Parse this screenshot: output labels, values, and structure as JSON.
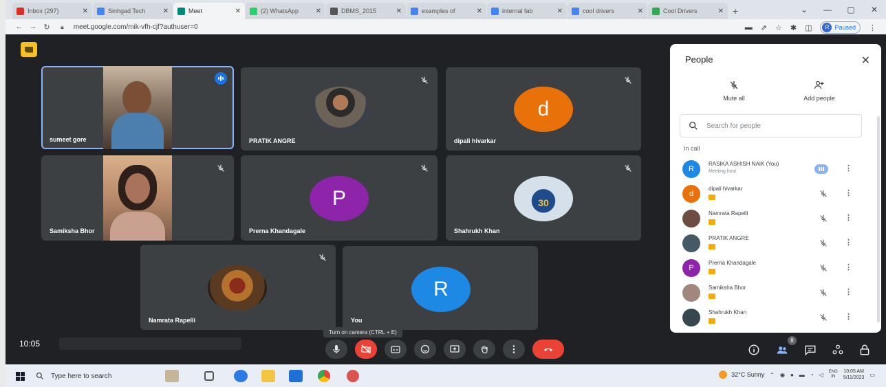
{
  "browser": {
    "tabs": [
      {
        "label": "Inbox (297)",
        "color": "#d93025",
        "active": false
      },
      {
        "label": "Sinhgad Tech",
        "color": "#4285f4",
        "active": false
      },
      {
        "label": "Meet",
        "color": "#00897b",
        "active": true
      },
      {
        "label": "(2) WhatsApp",
        "color": "#25d366",
        "active": false
      },
      {
        "label": "DBMS_2015",
        "color": "#555555",
        "active": false
      },
      {
        "label": "examples of",
        "color": "#4285f4",
        "active": false
      },
      {
        "label": "internal fab",
        "color": "#4285f4",
        "active": false
      },
      {
        "label": "cool drivers",
        "color": "#4285f4",
        "active": false
      },
      {
        "label": "Cool Drivers",
        "color": "#34a853",
        "active": false
      }
    ],
    "new_tab": "+",
    "url": "meet.google.com/mik-vfh-cjf?authuser=0",
    "profile_initial": "R",
    "profile_label": "Paused"
  },
  "meet": {
    "tiles": [
      {
        "name": "sumeet gore",
        "kind": "video"
      },
      {
        "name": "PRATIK ANGRE",
        "kind": "photo"
      },
      {
        "name": "dipali hivarkar",
        "kind": "avatar",
        "initial": "d",
        "color": "#e8710a"
      },
      {
        "name": "Samiksha Bhor",
        "kind": "video"
      },
      {
        "name": "Prerna Khandagale",
        "kind": "avatar",
        "initial": "P",
        "color": "#8e24aa"
      },
      {
        "name": "Shahrukh Khan",
        "kind": "photo",
        "jersey": "30"
      },
      {
        "name": "Namrata Rapelli",
        "kind": "photo"
      },
      {
        "name": "You",
        "kind": "avatar",
        "initial": "R",
        "color": "#1e88e5"
      }
    ],
    "clock": "10:05",
    "tooltip": "Turn on camera (CTRL + E)",
    "people_count": "8"
  },
  "panel": {
    "title": "People",
    "close": "✕",
    "mute_all": "Mute all",
    "add_people": "Add people",
    "search_placeholder": "Search for people",
    "in_call": "In call",
    "participants": [
      {
        "name": "RASIKA ASHISH NAIK (You)",
        "sub": "Meeting host",
        "initial": "R",
        "color": "#1e88e5",
        "speaking": true
      },
      {
        "name": "dipali hivarkar",
        "initial": "d",
        "color": "#e8710a",
        "speaking": false
      },
      {
        "name": "Namrata Rapelli",
        "initial": "",
        "color": "#6d4c41",
        "speaking": false
      },
      {
        "name": "PRATIK ANGRE",
        "initial": "",
        "color": "#455a64",
        "speaking": false
      },
      {
        "name": "Prerna Khandagale",
        "initial": "P",
        "color": "#8e24aa",
        "speaking": false
      },
      {
        "name": "Samiksha Bhor",
        "initial": "",
        "color": "#a1887f",
        "speaking": false
      },
      {
        "name": "Shahrukh Khan",
        "initial": "",
        "color": "#37474f",
        "speaking": false
      }
    ]
  },
  "taskbar": {
    "search_placeholder": "Type here to search",
    "weather": "32°C Sunny",
    "lang_top": "ENG",
    "lang_bottom": "IN",
    "time": "10:05 AM",
    "date": "5/11/2023"
  }
}
